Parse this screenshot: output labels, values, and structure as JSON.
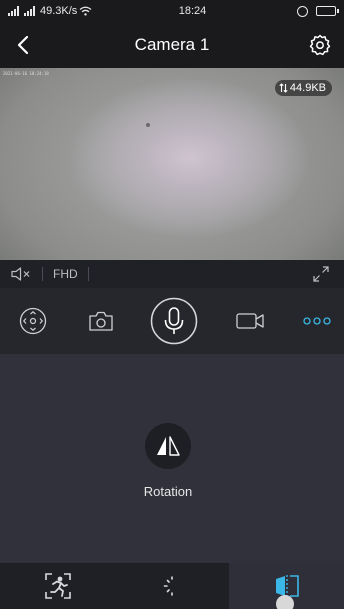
{
  "status_bar": {
    "network_speed": "49.3K/s",
    "time": "18:24"
  },
  "header": {
    "title": "Camera 1"
  },
  "video": {
    "bitrate": "44.9KB",
    "osd_text": "2021-06-16 18:24:18"
  },
  "video_bar": {
    "quality": "FHD"
  },
  "controls": {
    "items": [
      "ptz-control-icon",
      "snapshot-icon",
      "microphone-icon",
      "record-icon",
      "more-icon"
    ],
    "more_color": "#3ab7e6"
  },
  "panel": {
    "rotation_label": "Rotation"
  },
  "tabbar": {
    "tabs": [
      "motion-detection-icon",
      "night-vision-icon",
      "rotation-icon"
    ],
    "active_index": 2,
    "active_color": "#3ab7e6"
  }
}
